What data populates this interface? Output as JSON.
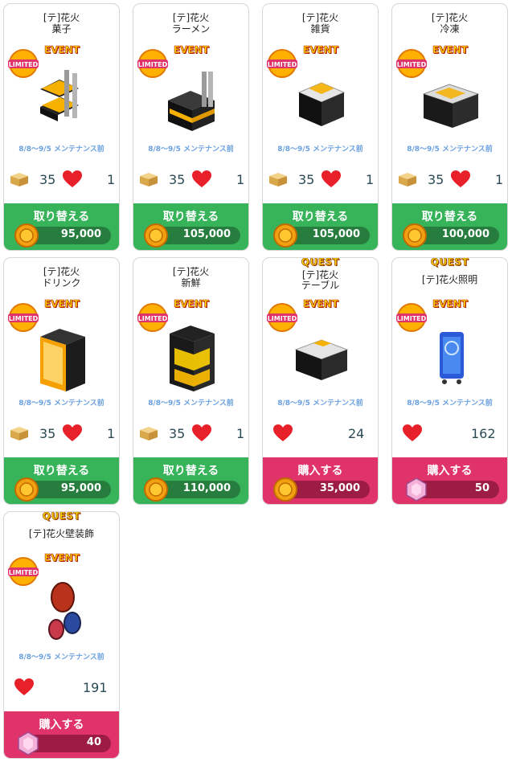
{
  "labels": {
    "quest": "QUEST",
    "event": "EVENT",
    "limited": "LIMITED",
    "period": "8/8〜9/5 メンテナンス前"
  },
  "colors": {
    "exchange": "#37b35a",
    "purchase": "#e0336a"
  },
  "items": [
    {
      "name1": "[テ]花火",
      "name2": "菓子",
      "box": "35",
      "hearts": "1",
      "action": "取り替える",
      "price": "95,000"
    },
    {
      "name1": "[テ]花火",
      "name2": "ラーメン",
      "box": "35",
      "hearts": "1",
      "action": "取り替える",
      "price": "105,000"
    },
    {
      "name1": "[テ]花火",
      "name2": "雑貨",
      "box": "35",
      "hearts": "1",
      "action": "取り替える",
      "price": "105,000"
    },
    {
      "name1": "[テ]花火",
      "name2": "冷凍",
      "box": "35",
      "hearts": "1",
      "action": "取り替える",
      "price": "100,000"
    },
    {
      "name1": "[テ]花火",
      "name2": "ドリンク",
      "box": "35",
      "hearts": "1",
      "action": "取り替える",
      "price": "95,000"
    },
    {
      "name1": "[テ]花火",
      "name2": "新鮮",
      "box": "35",
      "hearts": "1",
      "action": "取り替える",
      "price": "110,000"
    },
    {
      "name1": "[テ]花火",
      "name2": "テーブル",
      "hearts": "24",
      "action": "購入する",
      "price": "35,000"
    },
    {
      "name1": "",
      "name2": "[テ]花火照明",
      "hearts": "162",
      "action": "購入する",
      "price": "50"
    },
    {
      "name1": "",
      "name2": "[テ]花火壁装飾",
      "hearts": "191",
      "action": "購入する",
      "price": "40"
    }
  ]
}
